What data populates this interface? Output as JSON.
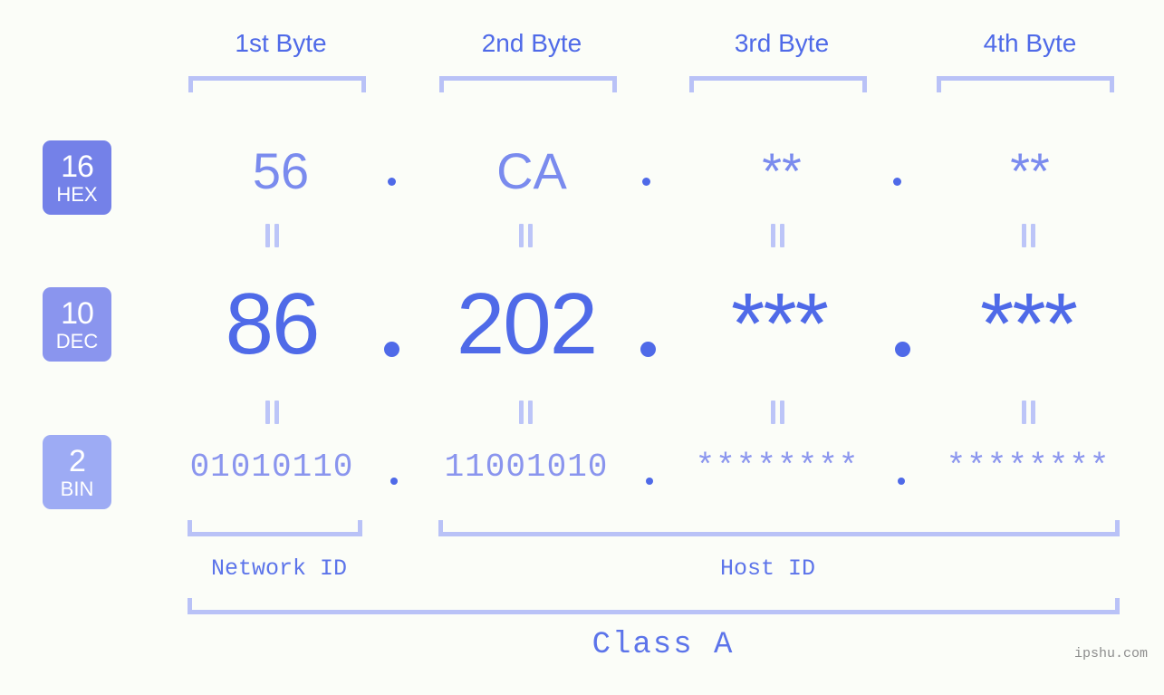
{
  "meta": {
    "watermark": "ipshu.com",
    "background": "#fbfdf8",
    "accent_strong": "#4f6ae8",
    "accent_mid": "#7a8bee",
    "accent_light": "#b9c2f7"
  },
  "byte_headers": [
    {
      "label": "1st Byte"
    },
    {
      "label": "2nd Byte"
    },
    {
      "label": "3rd Byte"
    },
    {
      "label": "4th Byte"
    }
  ],
  "rows": [
    {
      "radix_number": "16",
      "radix_name": "HEX",
      "badge_color": "#7481e8",
      "values": [
        "56",
        "CA",
        "**",
        "**"
      ],
      "separator": "."
    },
    {
      "radix_number": "10",
      "radix_name": "DEC",
      "badge_color": "#8a95ee",
      "values": [
        "86",
        "202",
        "***",
        "***"
      ],
      "separator": "."
    },
    {
      "radix_number": "2",
      "radix_name": "BIN",
      "badge_color": "#9dabf4",
      "values": [
        "01010110",
        "11001010",
        "********",
        "********"
      ],
      "separator": "."
    }
  ],
  "equals_symbol": "=",
  "segments": {
    "network_id": "Network ID",
    "host_id": "Host ID",
    "class": "Class A"
  }
}
